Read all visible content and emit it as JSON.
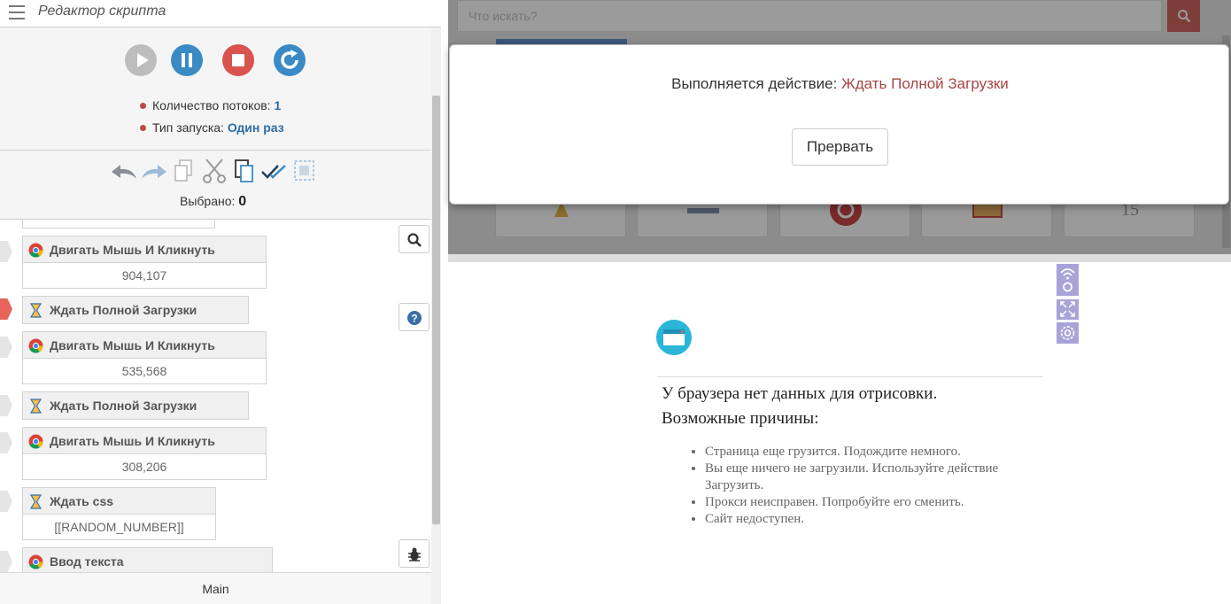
{
  "left_panel": {
    "title": "Редактор скрипта",
    "threads_label": "Количество потоков:",
    "threads_value": "1",
    "runtype_label": "Тип запуска:",
    "runtype_value": "Один раз",
    "selected_label": "Выбрано:",
    "selected_value": "0",
    "tab": "Main",
    "actions": [
      {
        "title": "Двигать Мышь И Кликнуть",
        "param": "904,107",
        "icon": "chrome-icon"
      },
      {
        "title": "Ждать Полной Загрузки",
        "param": "",
        "icon": "hourglass-icon",
        "active": true
      },
      {
        "title": "Двигать Мышь И Кликнуть",
        "param": "535,568",
        "icon": "chrome-icon"
      },
      {
        "title": "Ждать Полной Загрузки",
        "param": "",
        "icon": "hourglass-icon"
      },
      {
        "title": "Двигать Мышь И Кликнуть",
        "param": "308,206",
        "icon": "chrome-icon"
      },
      {
        "title": "Ждать css",
        "param": "[[RANDOM_NUMBER]]",
        "icon": "hourglass-icon"
      },
      {
        "title": "Ввод текста",
        "param": "",
        "icon": "chrome-icon"
      }
    ]
  },
  "browser": {
    "search_placeholder": "Что искать?"
  },
  "modal": {
    "prefix": "Выполняется действие:",
    "action": "Ждать Полной Загрузки",
    "abort_label": "Прервать"
  },
  "empty_browser": {
    "title": "У браузера нет данных для отрисовки.",
    "subtitle": "Возможные причины:",
    "reasons": [
      "Страница еще грузится. Подождите немного.",
      "Вы еще ничего не загрузили. Используйте действие Загрузить.",
      "Прокси неисправен. Попробуйте его сменить.",
      "Сайт недоступен."
    ]
  },
  "colors": {
    "accent_blue": "#3a8bc5",
    "stop_red": "#d9534f",
    "active_action": "#e8645a",
    "link_value": "#2d6ca2"
  }
}
